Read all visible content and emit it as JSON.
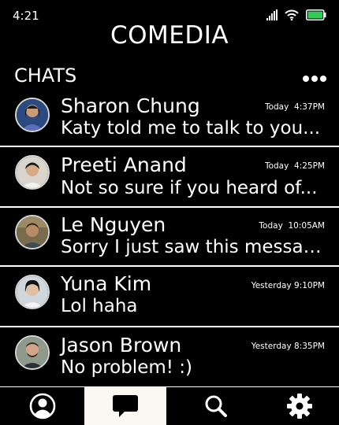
{
  "status_bar": {
    "time": "4:21",
    "battery_color": "#34c759"
  },
  "app": {
    "title": "COMEDIA"
  },
  "chats_section": {
    "header": "CHATS"
  },
  "chats": [
    {
      "name": "Sharon Chung",
      "message": "Katy told me to talk to you...",
      "day": "Today",
      "time": "4:37PM"
    },
    {
      "name": "Preeti Anand",
      "message": "Not so sure if you heard of...",
      "day": "Today",
      "time": "4:25PM"
    },
    {
      "name": "Le Nguyen",
      "message": "Sorry I just saw this message!",
      "day": "Today",
      "time": "10:05AM"
    },
    {
      "name": "Yuna Kim",
      "message": "Lol haha",
      "day": "Yesterday",
      "time": "9:10PM"
    },
    {
      "name": "Jason Brown",
      "message": "No problem! :)",
      "day": "Yesterday",
      "time": "8:35PM"
    }
  ],
  "tab_bar": {
    "tabs": [
      {
        "icon": "profile-icon",
        "active": false
      },
      {
        "icon": "chat-bubble-icon",
        "active": true
      },
      {
        "icon": "search-icon",
        "active": false
      },
      {
        "icon": "gear-icon",
        "active": false
      }
    ],
    "active_background": "#fbf8f2"
  }
}
